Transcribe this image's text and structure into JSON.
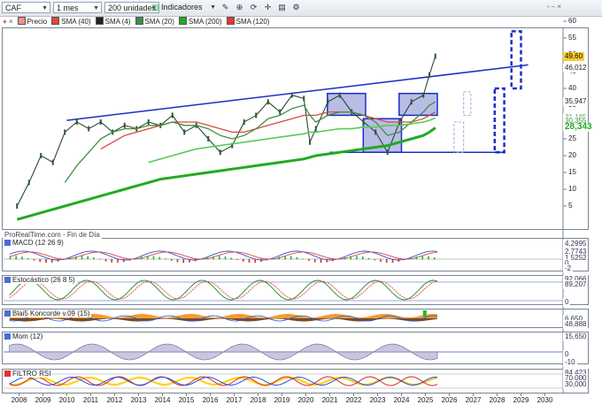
{
  "toolbar": {
    "symbol": "CAF",
    "period": "1 mes",
    "units": "200 unidades",
    "indicators": "Indicadores",
    "corner_controls": "▫ – ×"
  },
  "legend": [
    {
      "label": "Precio",
      "color": "#ff8a8a"
    },
    {
      "label": "SMA (40)",
      "color": "#d94a3a"
    },
    {
      "label": "SMA (4)",
      "color": "#222222"
    },
    {
      "label": "SMA (20)",
      "color": "#3f8f3f"
    },
    {
      "label": "SMA (200)",
      "color": "#22aa22"
    },
    {
      "label": "SMA (120)",
      "color": "#ee3333"
    }
  ],
  "price_axis": {
    "ticks": [
      5,
      10,
      15,
      20,
      25,
      30,
      35,
      40,
      45,
      50,
      55,
      60
    ]
  },
  "price_tags": [
    {
      "text": "49,60",
      "value": 49.6,
      "bg": "#ffcc33",
      "fg": "#000000"
    },
    {
      "text": "46,012",
      "value": 46.012,
      "bg": "#ffffff",
      "fg": "#222222"
    },
    {
      "text": "35,947",
      "value": 35.947,
      "bg": "#ffffff",
      "fg": "#222222"
    },
    {
      "text": "31,185",
      "value": 31.3,
      "bg": "#ffffff",
      "fg": "#55aa55"
    },
    {
      "text": "30,355",
      "value": 30.2,
      "bg": "#ffffff",
      "fg": "#448844"
    },
    {
      "text": "28,343",
      "value": 28.343,
      "bg": "#ffffff",
      "fg": "#22aa22"
    }
  ],
  "watermark": "ProRealTime.com - Fin de Día",
  "panels": {
    "macd": {
      "label": "MACD (12 26 9)",
      "tags": [
        "4,2995",
        "2,7743",
        "1,5252",
        "0",
        "-2"
      ]
    },
    "stoch": {
      "label": "Estocástico (26 8 5)",
      "tags": [
        "92,066",
        "89,207",
        "0"
      ]
    },
    "koncorde": {
      "label": "Blai5 Koncorde v.09 (15)",
      "tags": [
        "6,650",
        "48,888"
      ]
    },
    "mom": {
      "label": "Mom (12)",
      "tags": [
        "15,650",
        "0",
        "-10"
      ]
    },
    "rsi": {
      "label": "FILTRO RSI",
      "tags": [
        "84,423",
        "70,000",
        "30,000"
      ]
    }
  },
  "x_axis": {
    "years": [
      "2008",
      "2009",
      "2010",
      "2011",
      "2012",
      "2013",
      "2014",
      "2015",
      "2016",
      "2017",
      "2018",
      "2019",
      "2020",
      "2021",
      "2022",
      "2023",
      "2024",
      "2025",
      "2026",
      "2027",
      "2028",
      "2029",
      "2030"
    ]
  },
  "chart_data": {
    "type": "line",
    "title": "CAF",
    "xlabel": "",
    "ylabel": "",
    "ylim": [
      0,
      62
    ],
    "grid": false,
    "x": [
      "2007-12",
      "2008-06",
      "2008-12",
      "2009-06",
      "2009-12",
      "2010-06",
      "2010-12",
      "2011-06",
      "2011-12",
      "2012-06",
      "2012-12",
      "2013-06",
      "2013-12",
      "2014-06",
      "2014-12",
      "2015-06",
      "2015-12",
      "2016-06",
      "2016-12",
      "2017-06",
      "2017-12",
      "2018-06",
      "2018-12",
      "2019-06",
      "2019-12",
      "2020-03",
      "2020-06",
      "2020-12",
      "2021-06",
      "2021-12",
      "2022-06",
      "2022-12",
      "2023-06",
      "2023-12",
      "2024-06",
      "2024-12",
      "2025-03",
      "2025-06"
    ],
    "series": [
      {
        "name": "Precio",
        "values": [
          5,
          12,
          20,
          18,
          27,
          30,
          28,
          30,
          27,
          29,
          28,
          30,
          29,
          32,
          27,
          29,
          25,
          21,
          23,
          30,
          32,
          36,
          33,
          38,
          37,
          24,
          28,
          36,
          38,
          33,
          30,
          27,
          21,
          30,
          36,
          38,
          44,
          49.6
        ]
      },
      {
        "name": "SMA (40)",
        "values": [
          null,
          null,
          null,
          null,
          null,
          null,
          null,
          22,
          24,
          26,
          27,
          28,
          29,
          30,
          30,
          30,
          29,
          28,
          27,
          27,
          28,
          29,
          30,
          31,
          32,
          32,
          32,
          33,
          33,
          33,
          32,
          31,
          30,
          30,
          30,
          31,
          32,
          33
        ]
      },
      {
        "name": "SMA (20)",
        "values": [
          null,
          null,
          null,
          null,
          12,
          17,
          21,
          25,
          27,
          28,
          28,
          29,
          29,
          30,
          29,
          29,
          28,
          26,
          25,
          26,
          28,
          31,
          32,
          34,
          35,
          32,
          30,
          32,
          33,
          33,
          32,
          30,
          26,
          27,
          30,
          33,
          35,
          36
        ]
      },
      {
        "name": "SMA (200)",
        "values": [
          1,
          2,
          3,
          4,
          5,
          6,
          7,
          8,
          9,
          10,
          11,
          12,
          13,
          13.5,
          14,
          14.5,
          15,
          15.5,
          16,
          16.5,
          17,
          17.5,
          18,
          18.5,
          19,
          19.5,
          20,
          20.5,
          21,
          21.5,
          22,
          22.5,
          23,
          24,
          25,
          26,
          27,
          28.3
        ]
      },
      {
        "name": "SMA (120)",
        "values": [
          null,
          null,
          null,
          null,
          null,
          null,
          null,
          null,
          null,
          null,
          null,
          18,
          19,
          20,
          21,
          22,
          22.5,
          23,
          23.5,
          24,
          24.5,
          25,
          25.5,
          26,
          26.5,
          27,
          27,
          27.5,
          28,
          28,
          28.5,
          28.5,
          29,
          29,
          29.5,
          30,
          30.5,
          31.2
        ]
      }
    ]
  },
  "colors": {
    "trendline": "#1a2fc8",
    "box_fill": "#b8bde6",
    "axis": "#7a8592"
  }
}
